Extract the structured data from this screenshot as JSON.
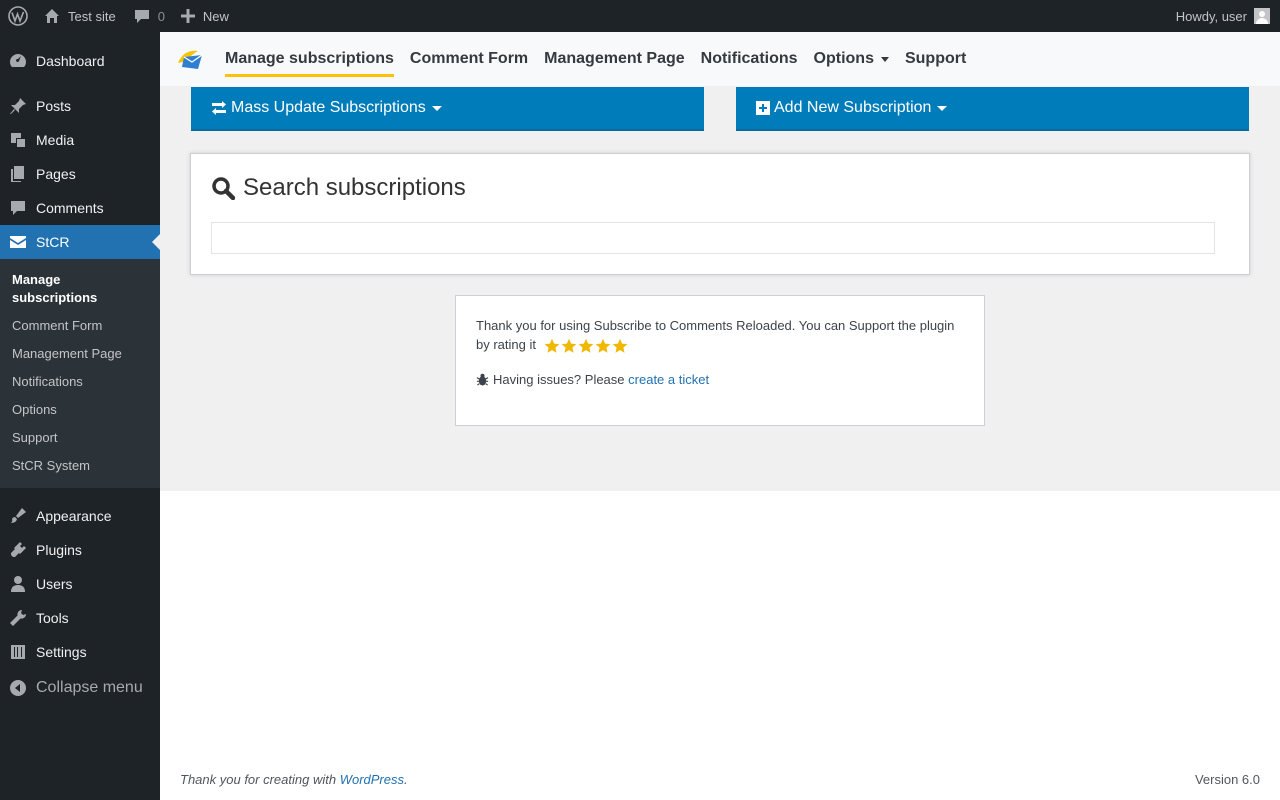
{
  "adminbar": {
    "site_name": "Test site",
    "comments_count": "0",
    "new_label": "New",
    "howdy": "Howdy, user"
  },
  "sidebar": {
    "items_top": [
      {
        "label": "Dashboard",
        "icon": "dashboard-icon"
      },
      {
        "label": "Posts",
        "icon": "pin-icon"
      },
      {
        "label": "Media",
        "icon": "media-icon"
      },
      {
        "label": "Pages",
        "icon": "pages-icon"
      },
      {
        "label": "Comments",
        "icon": "comment-icon"
      },
      {
        "label": "StCR",
        "icon": "envelope-icon"
      }
    ],
    "submenu": [
      "Manage subscriptions",
      "Comment Form",
      "Management Page",
      "Notifications",
      "Options",
      "Support",
      "StCR System"
    ],
    "items_bottom": [
      {
        "label": "Appearance",
        "icon": "brush-icon"
      },
      {
        "label": "Plugins",
        "icon": "plug-icon"
      },
      {
        "label": "Users",
        "icon": "user-icon"
      },
      {
        "label": "Tools",
        "icon": "wrench-icon"
      },
      {
        "label": "Settings",
        "icon": "sliders-icon"
      }
    ],
    "collapse_label": "Collapse menu"
  },
  "nav": {
    "tabs": [
      "Manage subscriptions",
      "Comment Form",
      "Management Page",
      "Notifications",
      "Options",
      "Support"
    ],
    "active": "Manage subscriptions"
  },
  "buttons": {
    "mass_update": "Mass Update Subscriptions",
    "add_new": "Add New Subscription"
  },
  "search": {
    "title": "Search subscriptions",
    "value": ""
  },
  "info": {
    "thanks": "Thank you for using Subscribe to Comments Reloaded. You can Support the plugin by rating it",
    "rating_stars": 5,
    "issues_prefix": "Having issues? Please",
    "ticket_link": "create a ticket"
  },
  "footer": {
    "thanks_prefix": "Thank you for creating with",
    "wordpress_link": "WordPress",
    "period": ".",
    "version": "Version 6.0"
  },
  "colors": {
    "accent": "#2271b1",
    "button_blue": "#007cba",
    "active_underline": "#ffc107",
    "star": "#f0b800"
  }
}
